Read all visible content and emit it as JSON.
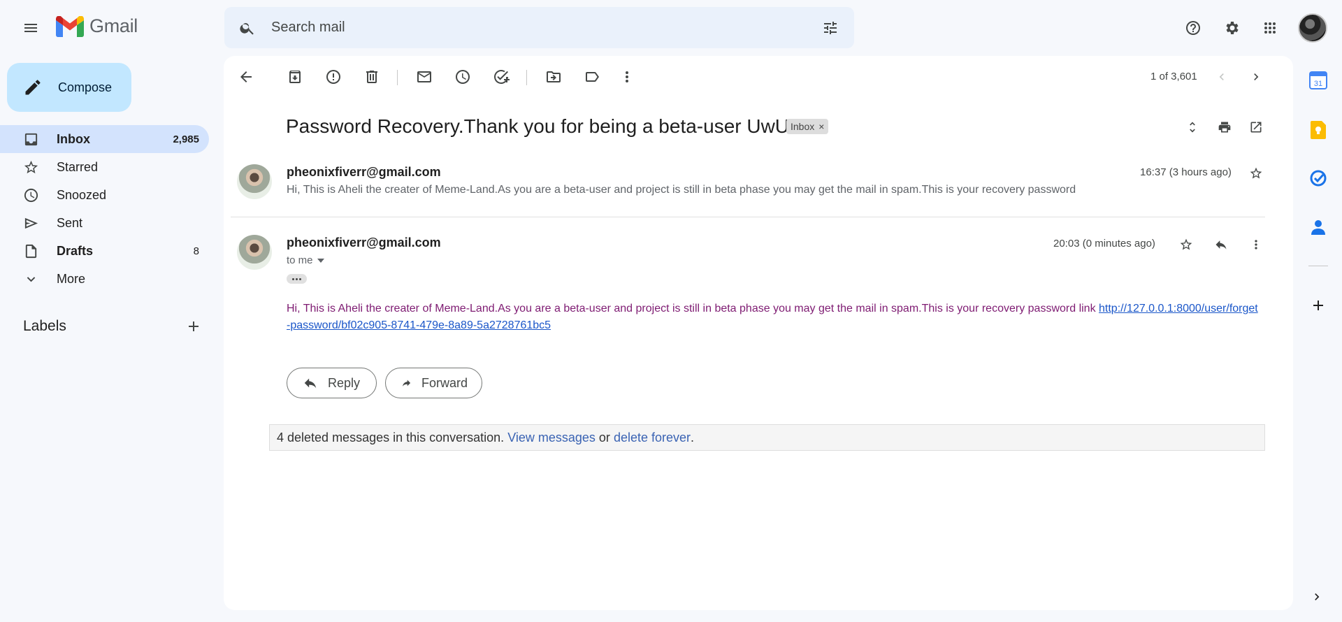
{
  "app": {
    "name": "Gmail"
  },
  "search": {
    "placeholder": "Search mail"
  },
  "sidebar": {
    "compose_label": "Compose",
    "items": [
      {
        "label": "Inbox",
        "count": "2,985",
        "icon": "inbox-icon"
      },
      {
        "label": "Starred",
        "count": "",
        "icon": "star-icon"
      },
      {
        "label": "Snoozed",
        "count": "",
        "icon": "clock-icon"
      },
      {
        "label": "Sent",
        "count": "",
        "icon": "send-icon"
      },
      {
        "label": "Drafts",
        "count": "8",
        "icon": "draft-icon"
      },
      {
        "label": "More",
        "count": "",
        "icon": "chevron-down-icon"
      }
    ],
    "labels_heading": "Labels"
  },
  "toolbar": {
    "pager": "1 of 3,601"
  },
  "thread": {
    "subject": "Password Recovery.Thank you for being a beta-user UwU",
    "label_chip": "Inbox",
    "messages": [
      {
        "sender": "pheonixfiverr@gmail.com",
        "time": "16:37 (3 hours ago)",
        "snippet": "Hi, This is Aheli the creater of Meme-Land.As you are a beta-user and project is still in beta phase you may get the mail in spam.This is your recovery password"
      },
      {
        "sender": "pheonixfiverr@gmail.com",
        "time": "20:03 (0 minutes ago)",
        "to": "to me",
        "body": "Hi, This is Aheli the creater of Meme-Land.As you are a beta-user and project is still in beta phase you may get the mail in spam.This is your recovery password link ",
        "link": "http://127.0.0.1:8000/user/forget-password/bf02c905-8741-479e-8a89-5a2728761bc5"
      }
    ],
    "reply_label": "Reply",
    "forward_label": "Forward",
    "deleted_notice": {
      "prefix": "4 deleted messages in this conversation.",
      "view_link": "View messages",
      "or": "or",
      "delete_link": "delete forever",
      "suffix": "."
    }
  },
  "side_panel": {
    "calendar_day": "31"
  },
  "colors": {
    "accent": "#0b57d0",
    "compose_bg": "#c2e7ff",
    "active_nav": "#d3e3fd",
    "body_text": "#7e1b72"
  }
}
